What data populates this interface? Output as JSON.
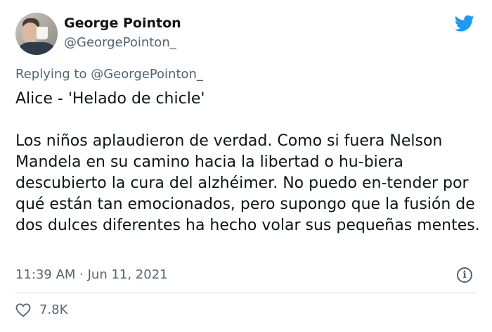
{
  "tweet": {
    "author_name": "George Pointon",
    "author_handle": "@GeorgePointon_",
    "replying_prefix": "Replying to ",
    "replying_to": "@GeorgePointon_",
    "body": "Alice - 'Helado de chicle'\n\nLos niños aplaudieron de verdad. Como si fuera Nelson Mandela en su camino hacia la libertad o hu-biera descubierto la cura del alzhéimer. No puedo en-tender por qué están tan emocionados, pero supongo que la fusión de dos dulces diferentes ha hecho volar sus pequeñas mentes.",
    "timestamp": "11:39 AM · Jun 11, 2021",
    "like_count": "7.8K",
    "info_glyph": "i"
  },
  "colors": {
    "twitter_blue": "#1d9bf0",
    "secondary_text": "#536471",
    "primary_text": "#0f1419",
    "divider": "#cfd9de"
  },
  "icons": {
    "brand": "twitter-bird-icon",
    "info": "info-icon",
    "like": "heart-icon"
  }
}
